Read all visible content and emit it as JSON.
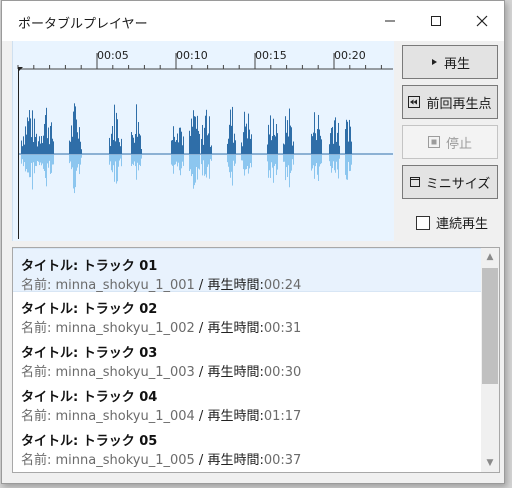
{
  "window": {
    "title": "ポータブルプレイヤー"
  },
  "waveform": {
    "time_labels": [
      "00:05",
      "00:10",
      "00:15",
      "00:20"
    ],
    "colors": {
      "top": "#2f6ea8",
      "bottom": "#8cc6ef",
      "background": "#e9f4ff"
    }
  },
  "controls": {
    "play_label": "再生",
    "prev_label": "前回再生点",
    "stop_label": "停止",
    "mini_label": "ミニサイズ",
    "continuous_label": "連続再生",
    "continuous_checked": false
  },
  "tracks": [
    {
      "title": "タイトル:  トラック 01",
      "name_label": "名前: ",
      "name": "minna_shokyu_1_001",
      "sep": " / ",
      "time_label": "再生時間:",
      "time": "00:24",
      "selected": true
    },
    {
      "title": "タイトル:  トラック 02",
      "name_label": "名前: ",
      "name": "minna_shokyu_1_002",
      "sep": " / ",
      "time_label": "再生時間:",
      "time": "00:31",
      "selected": false
    },
    {
      "title": "タイトル:  トラック 03",
      "name_label": "名前: ",
      "name": "minna_shokyu_1_003",
      "sep": " / ",
      "time_label": "再生時間:",
      "time": "00:30",
      "selected": false
    },
    {
      "title": "タイトル:  トラック 04",
      "name_label": "名前: ",
      "name": "minna_shokyu_1_004",
      "sep": " / ",
      "time_label": "再生時間:",
      "time": "01:17",
      "selected": false
    },
    {
      "title": "タイトル:  トラック 05",
      "name_label": "名前: ",
      "name": "minna_shokyu_1_005",
      "sep": " / ",
      "time_label": "再生時間:",
      "time": "00:37",
      "selected": false
    }
  ]
}
